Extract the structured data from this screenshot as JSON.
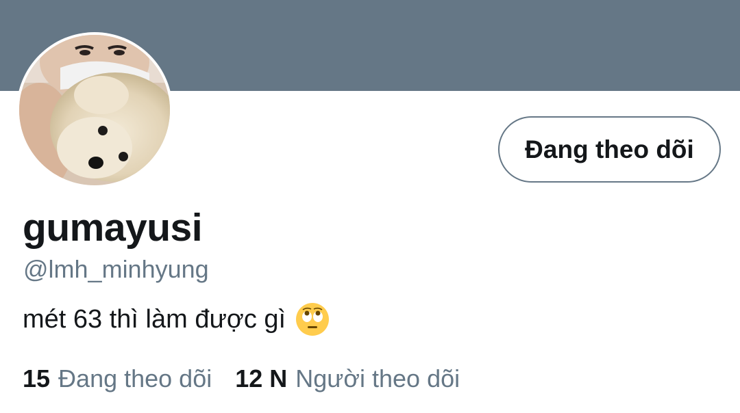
{
  "profile": {
    "display_name": "gumayusi",
    "handle": "@lmh_minhyung",
    "bio": "mét 63 thì làm được gì",
    "bio_emoji": "face-with-rolling-eyes-icon"
  },
  "follow_button": {
    "label": "Đang theo dõi"
  },
  "stats": {
    "following_count": "15",
    "following_label": "Đang theo dõi",
    "followers_count": "12 N",
    "followers_label": "Người theo dõi"
  },
  "colors": {
    "banner": "#657786",
    "text_primary": "#14171a",
    "text_secondary": "#657786",
    "emoji_yellow": "#ffcc4d"
  }
}
